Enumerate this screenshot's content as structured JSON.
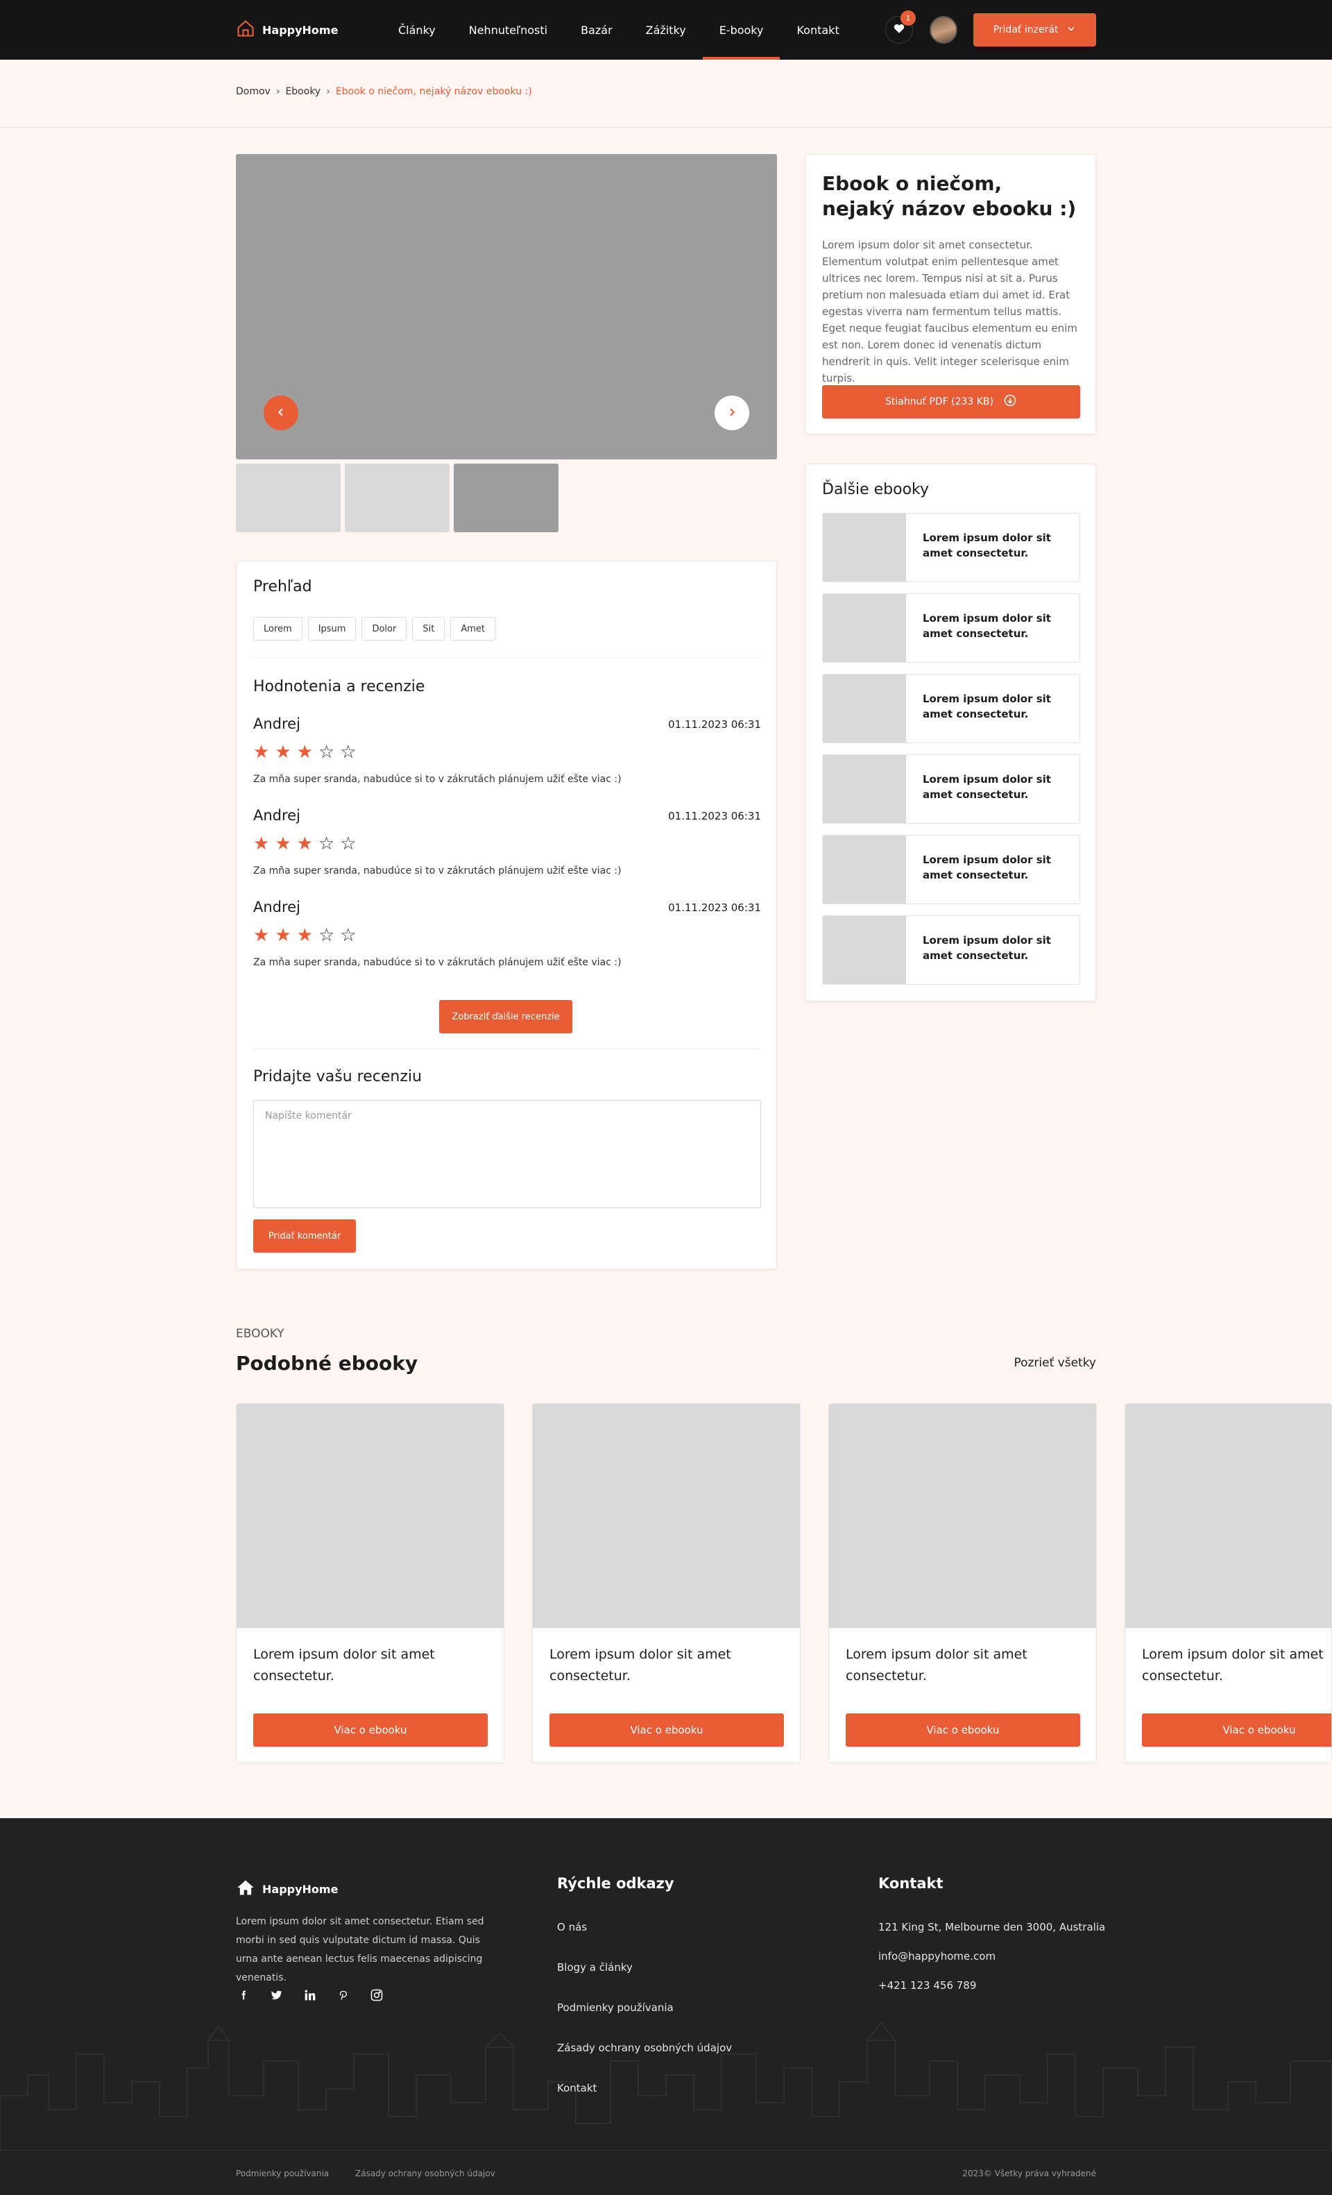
{
  "header": {
    "logo": "HappyHome",
    "nav": [
      "Články",
      "Nehnuteľnosti",
      "Bazár",
      "Zážitky",
      "E-booky",
      "Kontakt"
    ],
    "active_nav": "E-booky",
    "fav_count": "1",
    "add_button": "Pridať inzerát"
  },
  "breadcrumb": {
    "items": [
      "Domov",
      "Ebooky"
    ],
    "current": "Ebook o niečom, nejaký názov ebooku :)"
  },
  "ebook": {
    "title": "Ebook o niečom, nejaký názov ebooku :)",
    "description": "Lorem ipsum dolor sit amet consectetur. Elementum volutpat enim pellentesque amet ultrices nec lorem. Tempus nisi at sit a. Purus pretium non malesuada etiam dui amet id. Erat egestas viverra nam fermentum tellus mattis. Eget neque feugiat faucibus elementum eu enim est non. Lorem donec id venenatis dictum hendrerit in quis. Velit integer scelerisque enim turpis.",
    "download_label": "Stiahnuť PDF (233 KB)"
  },
  "overview": {
    "title": "Prehľad",
    "tags": [
      "Lorem",
      "Ipsum",
      "Dolor",
      "Sit",
      "Amet"
    ],
    "reviews_title": "Hodnotenia a recenzie",
    "reviews": [
      {
        "name": "Andrej",
        "date": "01.11.2023 06:31",
        "rating": 3,
        "max": 5,
        "text": "Za mňa super sranda, nabudúce si to v zákrutách plánujem užiť ešte viac :)"
      },
      {
        "name": "Andrej",
        "date": "01.11.2023 06:31",
        "rating": 3,
        "max": 5,
        "text": "Za mňa super sranda, nabudúce si to v zákrutách plánujem užiť ešte viac :)"
      },
      {
        "name": "Andrej",
        "date": "01.11.2023 06:31",
        "rating": 3,
        "max": 5,
        "text": "Za mňa super sranda, nabudúce si to v zákrutách plánujem užiť ešte viac :)"
      }
    ],
    "more_reviews_label": "Zobraziť ďalšie recenzie",
    "add_review_title": "Pridajte vašu recenziu",
    "comment_placeholder": "Napíšte komentár",
    "submit_label": "Pridať komentár"
  },
  "more_ebooks": {
    "title": "Ďalšie ebooky",
    "items": [
      "Lorem ipsum dolor sit amet consectetur.",
      "Lorem ipsum dolor sit amet consectetur.",
      "Lorem ipsum dolor sit amet consectetur.",
      "Lorem ipsum dolor sit amet consectetur.",
      "Lorem ipsum dolor sit amet consectetur.",
      "Lorem ipsum dolor sit amet consectetur."
    ]
  },
  "similar": {
    "label": "EBOOKY",
    "title": "Podobné ebooky",
    "see_all": "Pozrieť všetky",
    "cards": [
      {
        "title": "Lorem ipsum dolor sit amet consectetur.",
        "button": "Viac o ebooku"
      },
      {
        "title": "Lorem ipsum dolor sit amet consectetur.",
        "button": "Viac o ebooku"
      },
      {
        "title": "Lorem ipsum dolor sit amet consectetur.",
        "button": "Viac o ebooku"
      },
      {
        "title": "Lorem ipsum dolor sit amet consectetur.",
        "button": "Viac o ebooku"
      }
    ]
  },
  "footer": {
    "logo": "HappyHome",
    "description": "Lorem ipsum dolor sit amet consectetur. Etiam sed morbi in sed quis vulputate dictum id massa. Quis urna ante aenean lectus felis maecenas adipiscing venenatis.",
    "socials": [
      "facebook-icon",
      "twitter-icon",
      "linkedin-icon",
      "pinterest-icon",
      "instagram-icon"
    ],
    "quick_links_title": "Rýchle odkazy",
    "quick_links": [
      "O nás",
      "Blogy a články",
      "Podmienky používania",
      "Zásady ochrany osobných údajov",
      "Kontakt"
    ],
    "contact_title": "Kontakt",
    "address": "121 King St, Melbourne den 3000, Australia",
    "email": "info@happyhome.com",
    "phone": "+421 123 456 789",
    "bottom_links": [
      "Podmienky používania",
      "Zásady ochrany osobných údajov"
    ],
    "copyright": "2023© Všetky práva vyhradené"
  },
  "colors": {
    "accent": "#e85d35",
    "header_bg": "#151515",
    "page_bg": "#fff5f3",
    "footer_bg": "#222222"
  }
}
